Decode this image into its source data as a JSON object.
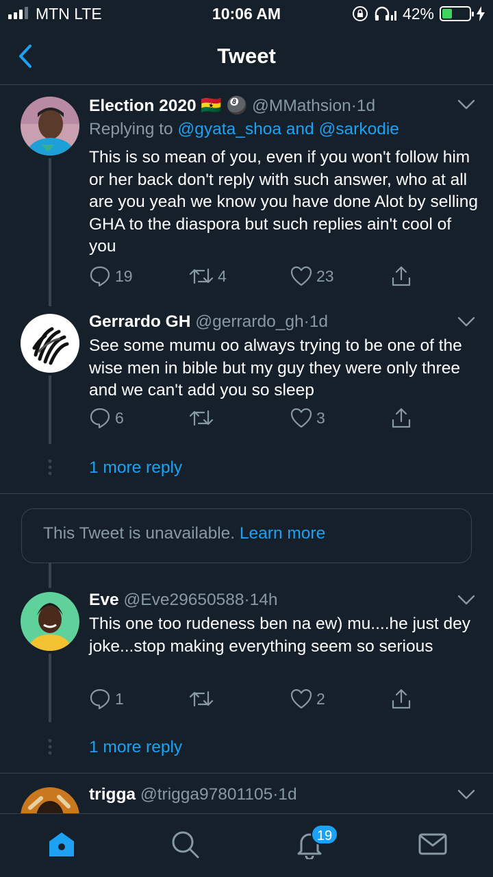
{
  "status_bar": {
    "carrier": "MTN   LTE",
    "time": "10:06 AM",
    "battery_percent": "42%",
    "battery_level": 0.42
  },
  "header": {
    "title": "Tweet"
  },
  "tweets": [
    {
      "name": "Election 2020 🇬🇭 🎱",
      "handle": "@MMathsion",
      "time": "1d",
      "replying_prefix": "Replying to ",
      "replying_links": "@gyata_shoa and @sarkodie",
      "text": "This is so mean of you, even if you won't follow him or her back don't reply with such answer, who at all are you yeah we know you have done Alot by selling GHA to the diaspora but such replies ain't cool of you",
      "replies": "19",
      "retweets": "4",
      "likes": "23"
    },
    {
      "name": "Gerrardo GH",
      "handle": "@gerrardo_gh",
      "time": "1d",
      "text": "See some mumu oo always trying to be one of the wise men in bible but my guy they were only three and we can't add you so sleep",
      "replies": "6",
      "retweets": "",
      "likes": "3",
      "more_reply": "1 more reply"
    },
    {
      "name": "Eve",
      "handle": "@Eve29650588",
      "time": "14h",
      "text": "This one too rudeness ben na ew) mu....he just dey joke...stop making everything seem so serious",
      "replies": "1",
      "retweets": "",
      "likes": "2",
      "more_reply": "1 more reply"
    },
    {
      "name": "trigga",
      "handle": "@trigga97801105",
      "time": "1d"
    }
  ],
  "unavailable": {
    "text": "This Tweet is unavailable. ",
    "link": "Learn more"
  },
  "dot_separator": "·",
  "tabbar": {
    "notifications_badge": "19",
    "icons": [
      "home-icon",
      "search-icon",
      "bell-icon",
      "mail-icon"
    ]
  },
  "colors": {
    "background": "#15202b",
    "accent": "#1da1f2",
    "muted": "#8899a6",
    "border": "#38444d",
    "battery": "#3fd45d"
  }
}
